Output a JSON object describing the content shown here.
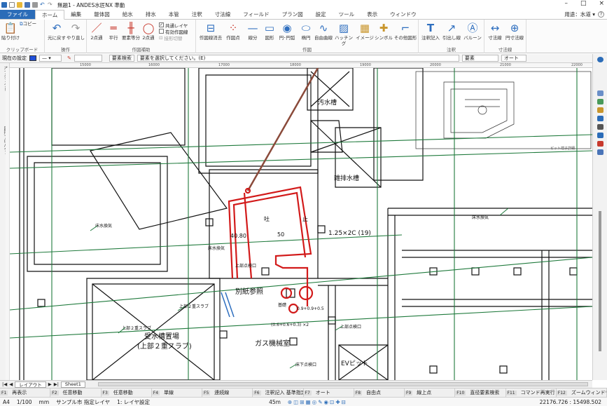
{
  "titlebar": {
    "title": "無題1 - ANDES水匠NX 準動",
    "min": "–",
    "max": "□",
    "close": "×"
  },
  "tabs": [
    "ファイル",
    "ホーム",
    "編集",
    "躯体図",
    "給水",
    "排水",
    "本管",
    "注釈",
    "寸法線",
    "フィールド",
    "プラン図",
    "設定",
    "ツール",
    "表示",
    "ウィンドウ"
  ],
  "tabbar_right": {
    "usage_label": "用途：水道 ▾",
    "help": "?"
  },
  "ribbon": {
    "clipboard": {
      "paste": "貼り付け",
      "copy": "コピー",
      "group": "クリップボード"
    },
    "operation": {
      "undo": "元に戻す",
      "redo": "やり直し",
      "group": "操作"
    },
    "drafting_aid": {
      "two_point": "2点通",
      "parallel": "平行",
      "equal_div": "要素等分",
      "two_point_circle": "2点通",
      "chk_common_layer": "共通レイヤ",
      "chk_valid_layer": "有効作図線",
      "chk_shape_switch": "接形切替",
      "group": "作図補助"
    },
    "draw": {
      "erase_all": "作図線消去",
      "drawpoint": "作図点",
      "line": "線分",
      "shape": "図形",
      "circle_arc": "円･円弧",
      "ellipse": "楕円",
      "freecurve": "自由曲線",
      "hatch": "ハッチング",
      "image": "イメージ",
      "symbol": "シンボル",
      "other_shape": "その他図形",
      "group": "作図"
    },
    "annotation": {
      "note": "注釈記入",
      "leader": "引出し線",
      "balloon": "バルーン",
      "group": "注釈"
    },
    "dimension": {
      "dimline": "寸法線",
      "circle_dim": "円寸法線",
      "group": "寸法線"
    }
  },
  "propbar": {
    "current_setting": "現在の設定",
    "color": "#1f4fd8",
    "search_button": "要素検索",
    "prompt": "要素を選択してください。(E)",
    "right_field": "要素",
    "auto": "オート"
  },
  "ruler_ticks": [
    "15000",
    "16000",
    "17000",
    "18000",
    "19000",
    "20000",
    "21000",
    "22000"
  ],
  "left_panel_labels": [
    "オブジェクト",
    "図形プロパティ"
  ],
  "drawing": {
    "labels": {
      "sewage_tank": "汚水槽",
      "misc_drain_tank": "雑排水槽",
      "pipe_spec": "1.25×2C (19)",
      "dim_4080": "40.80",
      "dim_50": "50",
      "dim_hook_left": "吐",
      "dim_hook_right": "止",
      "see_separate": "別紙参照",
      "foundation": "基礎",
      "size_note_a": "0.9+0.9+0.5",
      "size_note_b": "(0.6+0.6+0.3) ×2",
      "tank_place": "受水槽置場",
      "tank_place_sub": "(上部２重スラブ)",
      "gas_room": "ガス機械室",
      "ev_pit": "EVピット",
      "upper_slab_a": "上部２重スラブ",
      "upper_slab_b": "上部２重スラブ",
      "leader_small_a": "床水換気",
      "leader_small_b": "床水換気",
      "leader_small_c": "上部点検口",
      "leader_small_d": "上部点検口",
      "leader_small_e": "床下点検口",
      "leader_small_f": "床水換気",
      "inset_caption": "ピット端子詳細"
    }
  },
  "sheetbar": {
    "layout_tab": "レイアウト",
    "sheet_tab": "Sheet1"
  },
  "fkeys": [
    {
      "n": "F1",
      "label": "再表示"
    },
    {
      "n": "F2",
      "label": "任意移動"
    },
    {
      "n": "F3",
      "label": "任意移動"
    },
    {
      "n": "F4",
      "label": "単線"
    },
    {
      "n": "F5",
      "label": "連続線"
    },
    {
      "n": "F6",
      "label": "注釈記入 基準指定"
    },
    {
      "n": "F7",
      "label": "オート"
    },
    {
      "n": "F8",
      "label": "自由点"
    },
    {
      "n": "F9",
      "label": "線上点"
    },
    {
      "n": "F10",
      "label": "直径要素検索"
    },
    {
      "n": "F11",
      "label": "コマンド再実行"
    },
    {
      "n": "F12",
      "label": "ズームウィンドウ"
    }
  ],
  "status": {
    "paper": "A4",
    "scale": "1/100",
    "unit": "mm",
    "region": "サンプル市 指定レイヤ",
    "layer": "1: レイヤ設定",
    "angle": "45m",
    "coords": "22176.726 : 15498.502"
  }
}
